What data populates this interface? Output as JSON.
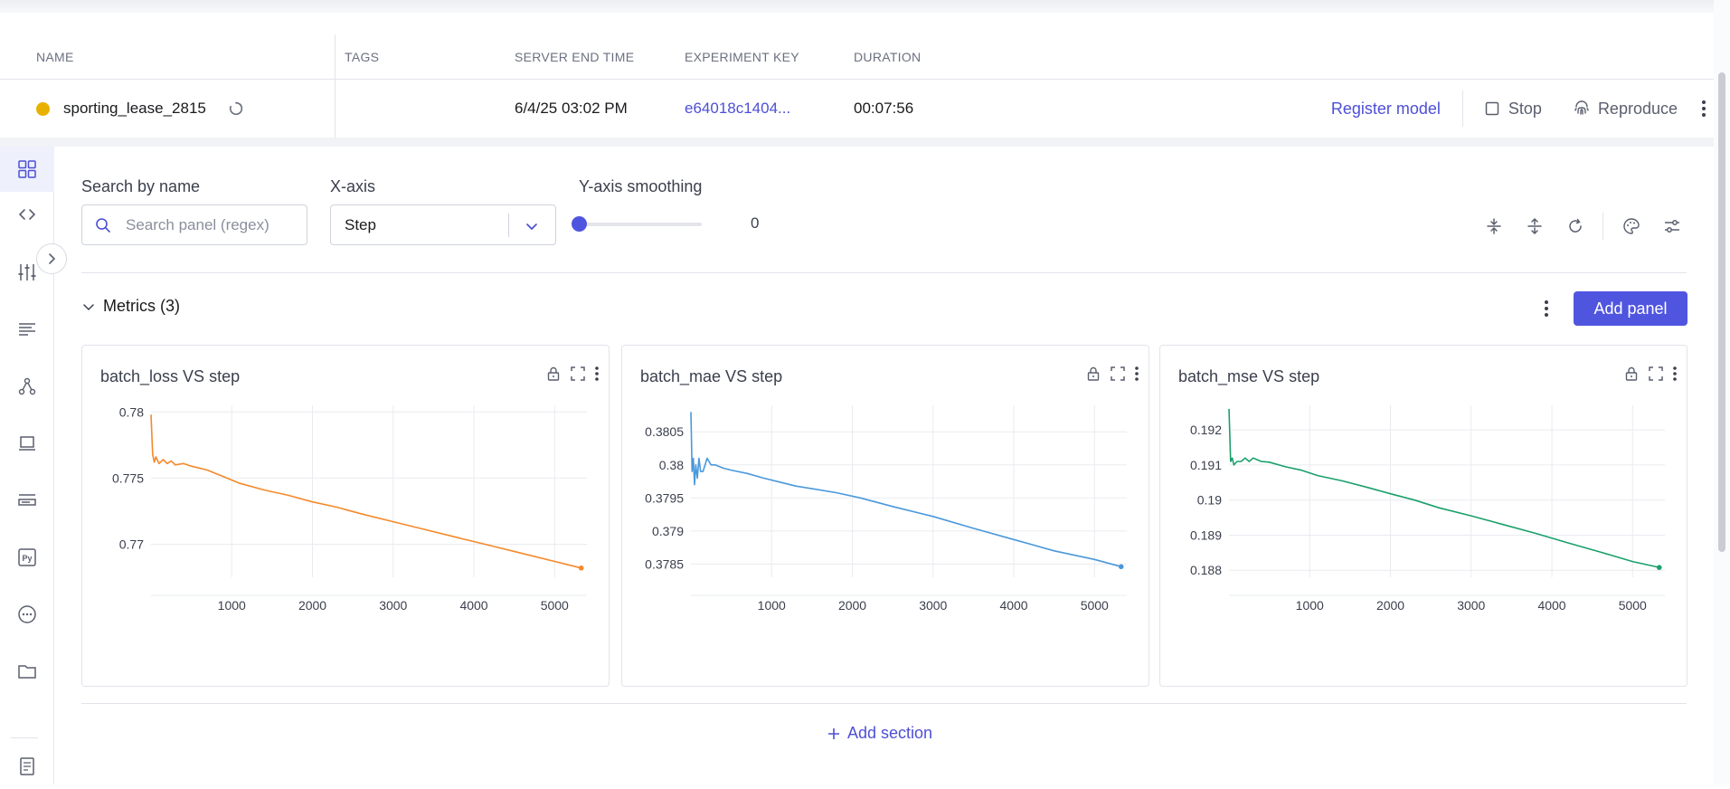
{
  "table": {
    "headers": [
      "NAME",
      "TAGS",
      "SERVER END TIME",
      "EXPERIMENT KEY",
      "DURATION"
    ],
    "row": {
      "name": "sporting_lease_2815",
      "tags": "",
      "server_end_time": "6/4/25 03:02 PM",
      "experiment_key": "e64018c1404...",
      "duration": "00:07:56",
      "status_color": "#e8b100"
    },
    "actions": {
      "register": "Register model",
      "stop": "Stop",
      "reproduce": "Reproduce"
    }
  },
  "sidebar": {
    "items": [
      "panels-icon",
      "code-icon",
      "hyperparameters-icon",
      "output-icon",
      "graph-icon",
      "system-icon",
      "notes-icon",
      "python-icon",
      "other-icon",
      "assets-icon",
      "html-icon"
    ]
  },
  "controls": {
    "search_label": "Search by name",
    "search_placeholder": "Search panel (regex)",
    "xaxis_label": "X-axis",
    "xaxis_value": "Step",
    "smoothing_label": "Y-axis smoothing",
    "smoothing_value": "0"
  },
  "section": {
    "title": "Metrics (3)",
    "add_panel": "Add panel",
    "add_section": "Add section"
  },
  "colors": {
    "accent": "#5055e0",
    "link": "#4d4fd6",
    "loss": "#f5892a",
    "mae": "#4a98dc",
    "mse": "#1aa06b"
  },
  "chart_data": [
    {
      "type": "line",
      "title": "batch_loss VS step",
      "xlabel": "",
      "ylabel": "",
      "xlim": [
        0,
        5400
      ],
      "ylim": [
        0.7675,
        0.7805
      ],
      "xticks": [
        1000,
        2000,
        3000,
        4000,
        5000
      ],
      "yticks": [
        0.77,
        0.775,
        0.78
      ],
      "ytick_labels": [
        "0.77",
        "0.775",
        "0.78"
      ],
      "grid": true,
      "series": [
        {
          "color": "#f5892a",
          "x": [
            0,
            20,
            40,
            60,
            100,
            150,
            200,
            250,
            300,
            400,
            500,
            700,
            900,
            1100,
            1400,
            1700,
            2000,
            2300,
            2600,
            3000,
            3400,
            3800,
            4200,
            4600,
            5000,
            5330
          ],
          "y": [
            0.7798,
            0.7768,
            0.7762,
            0.7766,
            0.7761,
            0.7764,
            0.7761,
            0.7763,
            0.776,
            0.7761,
            0.7759,
            0.7756,
            0.7751,
            0.7746,
            0.7741,
            0.7737,
            0.7732,
            0.7728,
            0.7723,
            0.7717,
            0.7711,
            0.7705,
            0.7699,
            0.7693,
            0.7687,
            0.7682
          ]
        }
      ]
    },
    {
      "type": "line",
      "title": "batch_mae VS step",
      "xlabel": "",
      "ylabel": "",
      "xlim": [
        0,
        5400
      ],
      "ylim": [
        0.3783,
        0.3809
      ],
      "xticks": [
        1000,
        2000,
        3000,
        4000,
        5000
      ],
      "yticks": [
        0.3785,
        0.379,
        0.3795,
        0.38,
        0.3805
      ],
      "ytick_labels": [
        "0.3785",
        "0.379",
        "0.3795",
        "0.38",
        "0.3805"
      ],
      "grid": true,
      "series": [
        {
          "color": "#4a98dc",
          "x": [
            0,
            15,
            30,
            45,
            60,
            80,
            100,
            120,
            150,
            200,
            250,
            300,
            400,
            500,
            700,
            900,
            1100,
            1300,
            1500,
            1800,
            2100,
            2500,
            3000,
            3500,
            4000,
            4500,
            5000,
            5330
          ],
          "y": [
            0.3808,
            0.3799,
            0.3801,
            0.3797,
            0.38,
            0.3798,
            0.3801,
            0.3799,
            0.3799,
            0.3801,
            0.38,
            0.38,
            0.37995,
            0.37992,
            0.37987,
            0.3798,
            0.37974,
            0.37968,
            0.37964,
            0.37958,
            0.3795,
            0.37937,
            0.37922,
            0.37904,
            0.37887,
            0.3787,
            0.37857,
            0.37846
          ]
        }
      ]
    },
    {
      "type": "line",
      "title": "batch_mse VS step",
      "xlabel": "",
      "ylabel": "",
      "xlim": [
        0,
        5400
      ],
      "ylim": [
        0.1878,
        0.1927
      ],
      "xticks": [
        1000,
        2000,
        3000,
        4000,
        5000
      ],
      "yticks": [
        0.188,
        0.189,
        0.19,
        0.191,
        0.192
      ],
      "ytick_labels": [
        "0.188",
        "0.189",
        "0.19",
        "0.191",
        "0.192"
      ],
      "grid": true,
      "series": [
        {
          "color": "#1aa06b",
          "x": [
            0,
            20,
            40,
            60,
            100,
            150,
            200,
            250,
            300,
            400,
            500,
            700,
            900,
            1100,
            1400,
            1700,
            2000,
            2300,
            2600,
            3000,
            3400,
            3800,
            4200,
            4600,
            5000,
            5330
          ],
          "y": [
            0.1926,
            0.1911,
            0.1912,
            0.191,
            0.1911,
            0.1911,
            0.1912,
            0.1911,
            0.1912,
            0.1911,
            0.19108,
            0.19095,
            0.19085,
            0.1907,
            0.19055,
            0.19037,
            0.19018,
            0.19,
            0.18978,
            0.18955,
            0.1893,
            0.18905,
            0.18878,
            0.18852,
            0.18825,
            0.18808
          ]
        }
      ]
    }
  ]
}
